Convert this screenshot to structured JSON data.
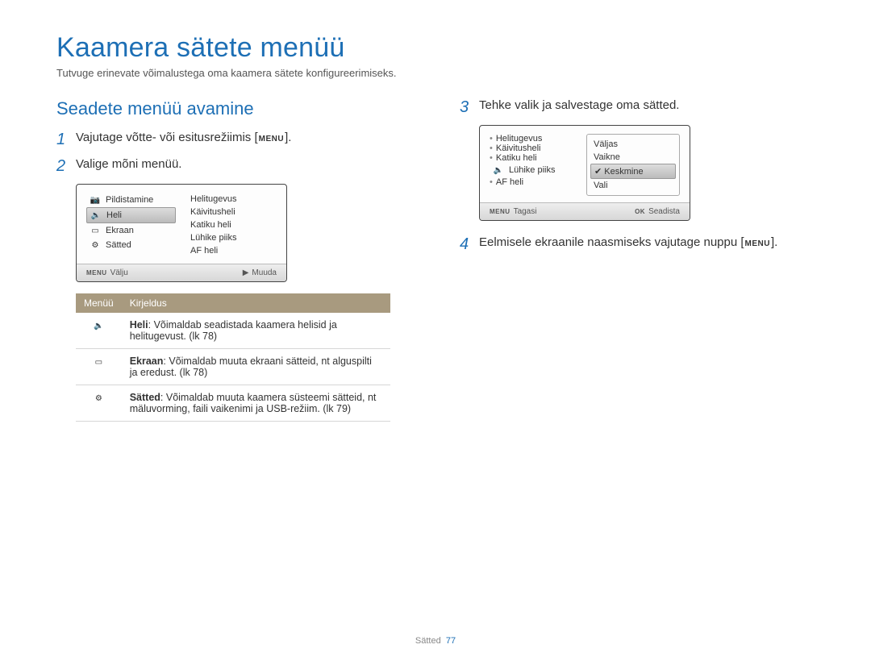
{
  "title": "Kaamera sätete menüü",
  "subtitle": "Tutvuge erinevate võimalustega oma kaamera sätete konfigureerimiseks.",
  "section_heading": "Seadete menüü avamine",
  "steps": {
    "s1": {
      "num": "1",
      "text_a": "Vajutage võtte- või esitusrežiimis [",
      "text_b": "]."
    },
    "s2": {
      "num": "2",
      "text": "Valige mõni menüü."
    },
    "s3": {
      "num": "3",
      "text": "Tehke valik ja salvestage oma sätted."
    },
    "s4": {
      "num": "4",
      "text_a": "Eelmisele ekraanile naasmiseks vajutage nuppu [",
      "text_b": "]."
    }
  },
  "menu_label": "MENU",
  "screen1": {
    "left": [
      {
        "icon": "camera",
        "label": "Pildistamine",
        "selected": false
      },
      {
        "icon": "sound",
        "label": "Heli",
        "selected": true
      },
      {
        "icon": "display",
        "label": "Ekraan",
        "selected": false
      },
      {
        "icon": "gear",
        "label": "Sätted",
        "selected": false
      }
    ],
    "right": [
      "Helitugevus",
      "Käivitusheli",
      "Katiku heli",
      "Lühike piiks",
      "AF heli"
    ],
    "foot_left_tag": "MENU",
    "foot_left": "Välju",
    "foot_right_sym": "▶",
    "foot_right": "Muuda"
  },
  "screen2": {
    "left": [
      "Helitugevus",
      "Käivitusheli",
      "Katiku heli",
      "Lühike piiks",
      "AF heli"
    ],
    "left_highlight_index": 3,
    "right": [
      "Väljas",
      "Vaikne",
      "Keskmine",
      "Vali"
    ],
    "right_selected_index": 2,
    "foot_left_tag": "MENU",
    "foot_left": "Tagasi",
    "foot_right_tag": "OK",
    "foot_right": "Seadista"
  },
  "table": {
    "head_menu": "Menüü",
    "head_desc": "Kirjeldus",
    "rows": [
      {
        "icon": "sound",
        "bold": "Heli",
        "rest": ": Võimaldab seadistada kaamera helisid ja helitugevust. (lk 78)"
      },
      {
        "icon": "display",
        "bold": "Ekraan",
        "rest": ": Võimaldab muuta ekraani sätteid, nt alguspilti ja eredust. (lk 78)"
      },
      {
        "icon": "gear",
        "bold": "Sätted",
        "rest": ": Võimaldab muuta kaamera süsteemi sätteid, nt mäluvorming, faili vaikenimi ja USB-režiim. (lk 79)"
      }
    ]
  },
  "footer": {
    "section": "Sätted",
    "page": "77"
  }
}
